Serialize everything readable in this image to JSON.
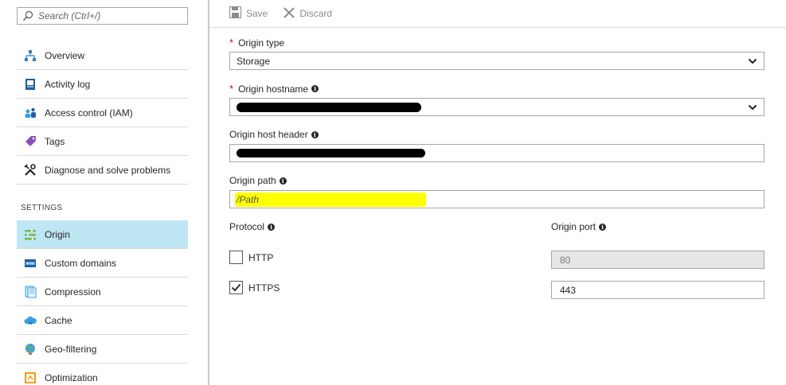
{
  "search": {
    "placeholder": "Search (Ctrl+/)"
  },
  "sidebar": {
    "items": [
      {
        "label": "Overview",
        "icon": "overview-icon"
      },
      {
        "label": "Activity log",
        "icon": "activity-log-icon"
      },
      {
        "label": "Access control (IAM)",
        "icon": "access-control-icon"
      },
      {
        "label": "Tags",
        "icon": "tag-icon"
      },
      {
        "label": "Diagnose and solve problems",
        "icon": "wrench-icon"
      }
    ],
    "section_label": "SETTINGS",
    "settings_items": [
      {
        "label": "Origin",
        "icon": "origin-icon",
        "active": true
      },
      {
        "label": "Custom domains",
        "icon": "custom-domains-icon"
      },
      {
        "label": "Compression",
        "icon": "compression-icon"
      },
      {
        "label": "Cache",
        "icon": "cache-icon"
      },
      {
        "label": "Geo-filtering",
        "icon": "globe-icon"
      },
      {
        "label": "Optimization",
        "icon": "optimization-icon"
      }
    ]
  },
  "toolbar": {
    "save_label": "Save",
    "discard_label": "Discard"
  },
  "form": {
    "origin_type": {
      "label": "Origin type",
      "value": "Storage"
    },
    "origin_hostname": {
      "label": "Origin hostname"
    },
    "origin_host_header": {
      "label": "Origin host header"
    },
    "origin_path": {
      "label": "Origin path",
      "value": "/Path"
    },
    "protocol": {
      "label": "Protocol",
      "http": {
        "label": "HTTP",
        "checked": false
      },
      "https": {
        "label": "HTTPS",
        "checked": true
      }
    },
    "origin_port": {
      "label": "Origin port",
      "http_value": "80",
      "https_value": "443"
    }
  },
  "colors": {
    "active_bg": "#bfe6f5",
    "accent": "#0078d4",
    "highlight": "#ffff00",
    "required": "#e00000"
  }
}
